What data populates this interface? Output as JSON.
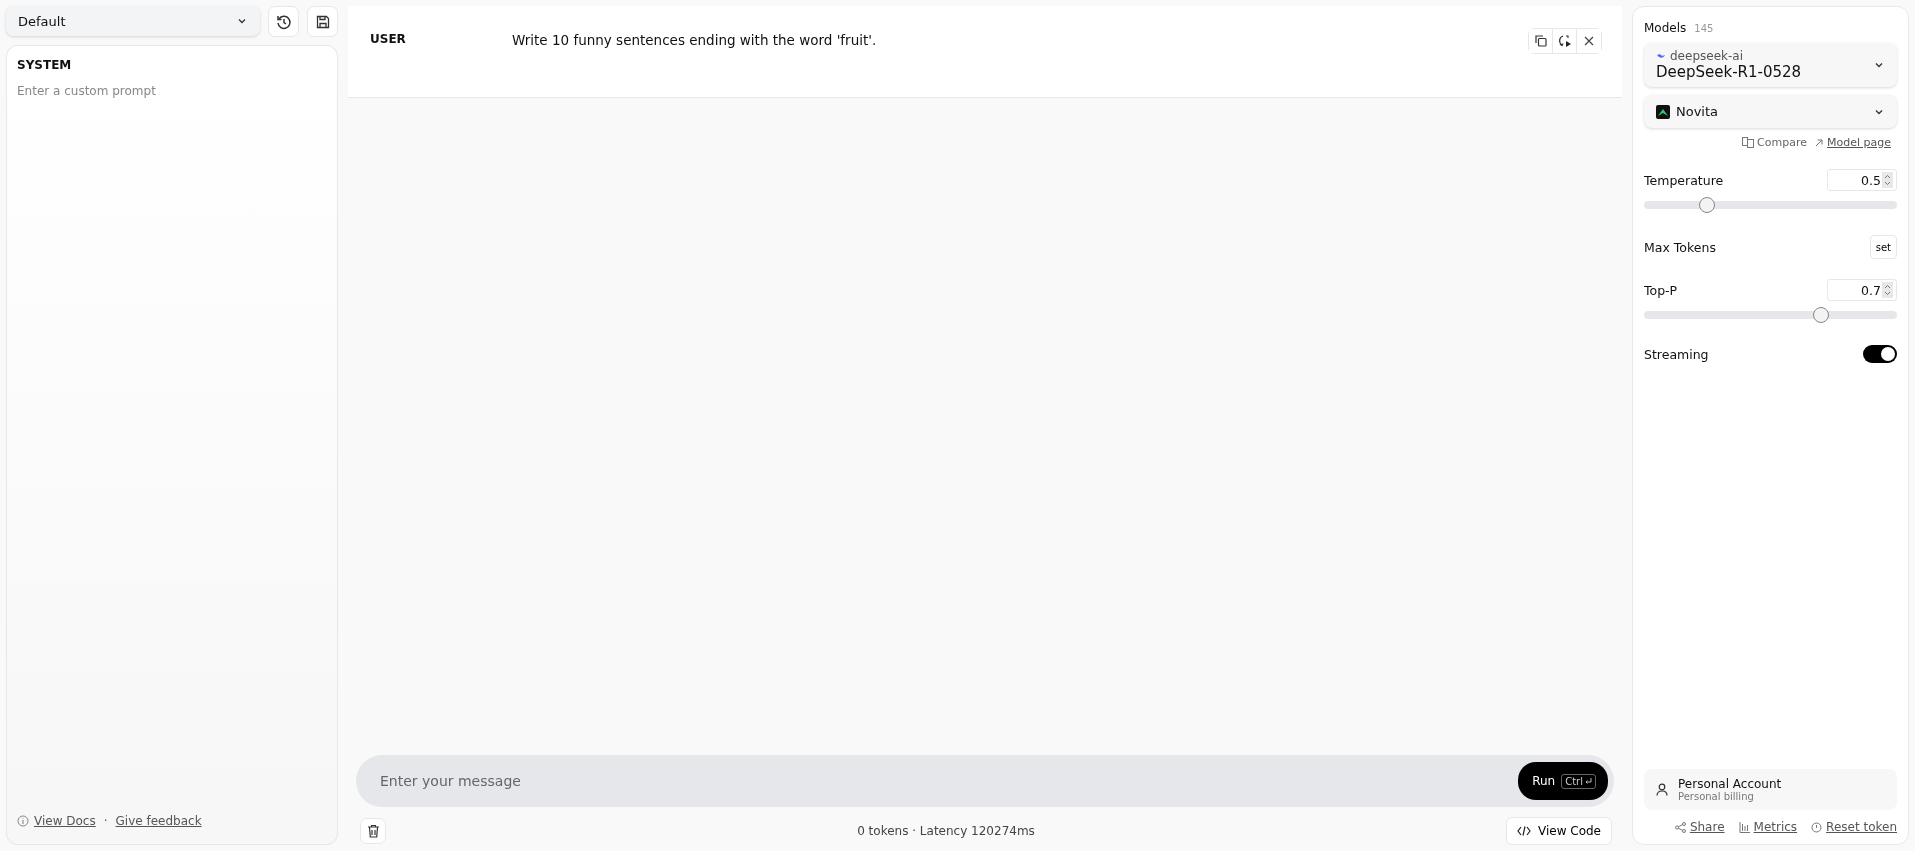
{
  "preset": {
    "value": "Default"
  },
  "system": {
    "label": "SYSTEM",
    "placeholder": "Enter a custom prompt"
  },
  "sidebar_footer": {
    "docs_link": "View Docs",
    "separator": "·",
    "feedback_link": "Give feedback"
  },
  "messages": [
    {
      "role": "USER",
      "text": "Write 10 funny sentences ending with the word 'fruit'."
    }
  ],
  "composer": {
    "placeholder": "Enter your message",
    "run_label": "Run",
    "shortcut": "Ctrl"
  },
  "status": {
    "text": "0 tokens · Latency 120274ms",
    "view_code": "View Code"
  },
  "settings": {
    "models_label": "Models",
    "models_count": "145",
    "model": {
      "org": "deepseek-ai",
      "name": "DeepSeek-R1-0528"
    },
    "provider": "Novita",
    "compare": "Compare",
    "model_page": "Model page",
    "params": [
      {
        "kind": "slider",
        "label": "Temperature",
        "value": "0.5",
        "level": 0.25
      },
      {
        "kind": "button",
        "label": "Max Tokens",
        "button": "set"
      },
      {
        "kind": "slider",
        "label": "Top-P",
        "value": "0.7",
        "level": 0.7
      },
      {
        "kind": "toggle",
        "label": "Streaming",
        "on": true
      }
    ]
  },
  "account": {
    "name": "Personal Account",
    "billing": "Personal billing"
  },
  "footer_links": [
    "Share",
    "Metrics",
    "Reset token"
  ]
}
